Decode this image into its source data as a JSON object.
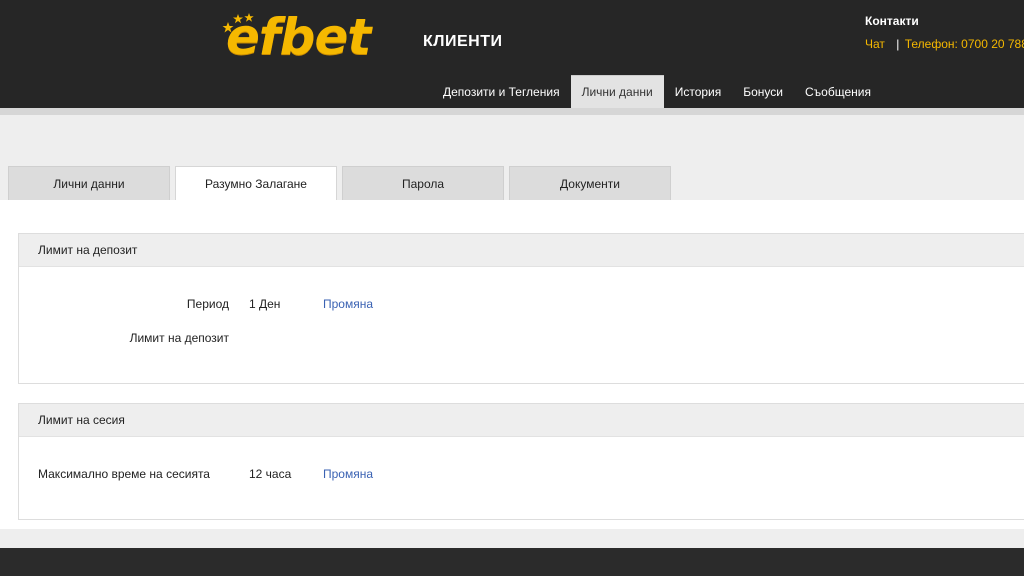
{
  "brand": {
    "logo_text": "efbet",
    "subtitle": "КЛИЕНТИ"
  },
  "contacts": {
    "title": "Контакти",
    "chat": "Чат",
    "separator": "|",
    "phone": "Телефон: 0700 20 788",
    "trailing": "|"
  },
  "topnav": {
    "items": [
      {
        "label": "Депозити и Тегления"
      },
      {
        "label": "Лични данни"
      },
      {
        "label": "История"
      },
      {
        "label": "Бонуси"
      },
      {
        "label": "Съобщения"
      }
    ],
    "active_index": 1
  },
  "tabs": {
    "items": [
      {
        "label": "Лични данни"
      },
      {
        "label": "Разумно Залагане"
      },
      {
        "label": "Парола"
      },
      {
        "label": "Документи"
      }
    ],
    "active_index": 1
  },
  "deposit_limit": {
    "title": "Лимит на депозит",
    "period_label": "Период",
    "period_value": "1 Ден",
    "period_action": "Промяна",
    "limit_label": "Лимит на депозит"
  },
  "session_limit": {
    "title": "Лимит на сесия",
    "max_time_label": "Максимално време на сесията",
    "max_time_value": "12 часа",
    "action": "Промяна"
  },
  "colors": {
    "brand_yellow": "#f5b800",
    "header_bg": "#262626",
    "link_blue": "#3a62b3"
  }
}
